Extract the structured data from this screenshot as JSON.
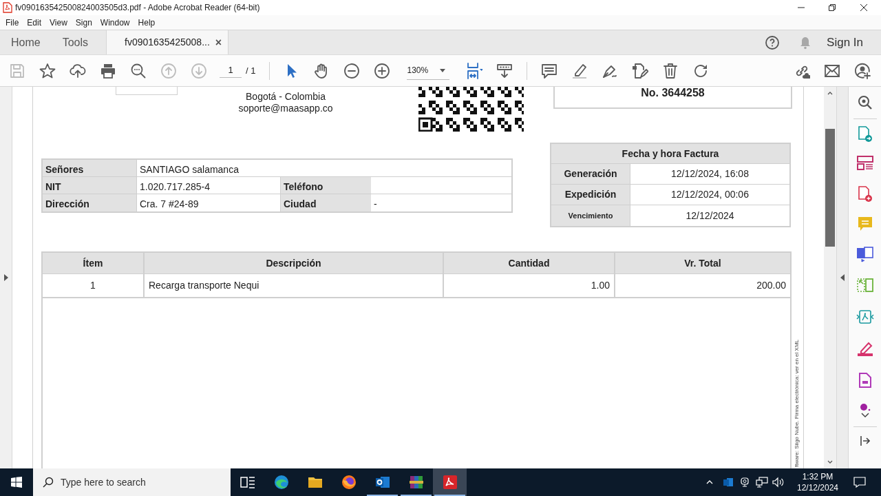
{
  "window": {
    "title": "fv090163542500824003505d3.pdf - Adobe Acrobat Reader (64-bit)"
  },
  "menu": [
    "File",
    "Edit",
    "View",
    "Sign",
    "Window",
    "Help"
  ],
  "tabs": [
    {
      "label": "Home",
      "kind": "nav",
      "selected": false
    },
    {
      "label": "Tools",
      "kind": "nav",
      "selected": false
    },
    {
      "label": "fv0901635425008...",
      "kind": "document",
      "selected": true,
      "close": "×"
    }
  ],
  "account": {
    "sign_in": "Sign In"
  },
  "toolbar": {
    "file_tools": [
      {
        "kind": "save",
        "disabled": true
      },
      {
        "kind": "star",
        "disabled": false
      },
      {
        "kind": "upload",
        "disabled": false
      },
      {
        "kind": "print",
        "disabled": false
      },
      {
        "kind": "zoom_search",
        "disabled": false
      },
      {
        "kind": "prev",
        "disabled": true
      },
      {
        "kind": "next",
        "disabled": true
      }
    ],
    "page_current": "1",
    "page_total": "/ 1",
    "modes": [
      {
        "kind": "select",
        "selected": true
      },
      {
        "kind": "hand",
        "selected": false
      }
    ],
    "zoom_tools": [
      {
        "kind": "zoom_out",
        "disabled": false
      },
      {
        "kind": "zoom_in",
        "disabled": false
      }
    ],
    "zoom": "130%",
    "view_tools": [
      {
        "kind": "fit",
        "disabled": false
      },
      {
        "kind": "scroll",
        "disabled": false
      }
    ],
    "edit_tools": [
      {
        "kind": "comment",
        "disabled": false
      },
      {
        "kind": "highlight",
        "disabled": false
      },
      {
        "kind": "sign",
        "disabled": false
      },
      {
        "kind": "edit",
        "disabled": false
      },
      {
        "kind": "trash",
        "disabled": false
      },
      {
        "kind": "rotate",
        "disabled": false
      }
    ],
    "share_tools": [
      {
        "kind": "link",
        "disabled": false
      },
      {
        "kind": "mail",
        "disabled": false
      },
      {
        "kind": "user_add",
        "disabled": false
      }
    ]
  },
  "document": {
    "issuer_lines": [
      "Bogotá - Colombia",
      "soporte@maasapp.co"
    ],
    "invoice_number": "No. 3644258",
    "client": {
      "rows": [
        [
          {
            "kind": "label",
            "text": "Señores"
          },
          {
            "kind": "wide_value",
            "text": "SANTIAGO salamanca"
          }
        ],
        [
          {
            "kind": "label",
            "text": "NIT"
          },
          {
            "kind": "value",
            "text": "1.020.717.285-4"
          },
          {
            "kind": "label",
            "text": "Teléfono"
          },
          {
            "kind": "value"
          }
        ],
        [
          {
            "kind": "label",
            "text": "Dirección"
          },
          {
            "kind": "value",
            "text": "Cra. 7 #24-89"
          },
          {
            "kind": "label",
            "text": "Ciudad"
          },
          {
            "kind": "value",
            "text": "-"
          }
        ]
      ]
    },
    "dates": {
      "title": "Fecha y hora Factura",
      "rows": [
        {
          "label": "Generación",
          "value": "12/12/2024, 16:08",
          "compact": false
        },
        {
          "label": "Expedición",
          "value": "12/12/2024, 00:06",
          "compact": false
        },
        {
          "label": "Vencimiento",
          "value": "12/12/2024",
          "compact": true
        }
      ]
    },
    "items": {
      "columns": [
        "Ítem",
        "Descripción",
        "Cantidad",
        "Vr. Total"
      ],
      "rows": [
        [
          "1",
          "Recarga transporte Nequi",
          "1.00",
          "200.00"
        ]
      ]
    },
    "side_note": "ftware: Siigo Nube. Firma electrónica: ver en el XML"
  },
  "taskbar": {
    "search_placeholder": "Type here to search",
    "time": "1:32 PM",
    "date": "12/12/2024",
    "apps": [
      {
        "kind": "taskview",
        "running": false,
        "selected": false
      },
      {
        "kind": "edge",
        "running": false,
        "selected": false
      },
      {
        "kind": "explorer",
        "running": false,
        "selected": false
      },
      {
        "kind": "firefox",
        "running": false,
        "selected": false
      },
      {
        "kind": "outlook",
        "running": true,
        "selected": false
      },
      {
        "kind": "winrar",
        "running": true,
        "selected": false
      },
      {
        "kind": "acrobat",
        "running": true,
        "selected": true
      }
    ]
  }
}
